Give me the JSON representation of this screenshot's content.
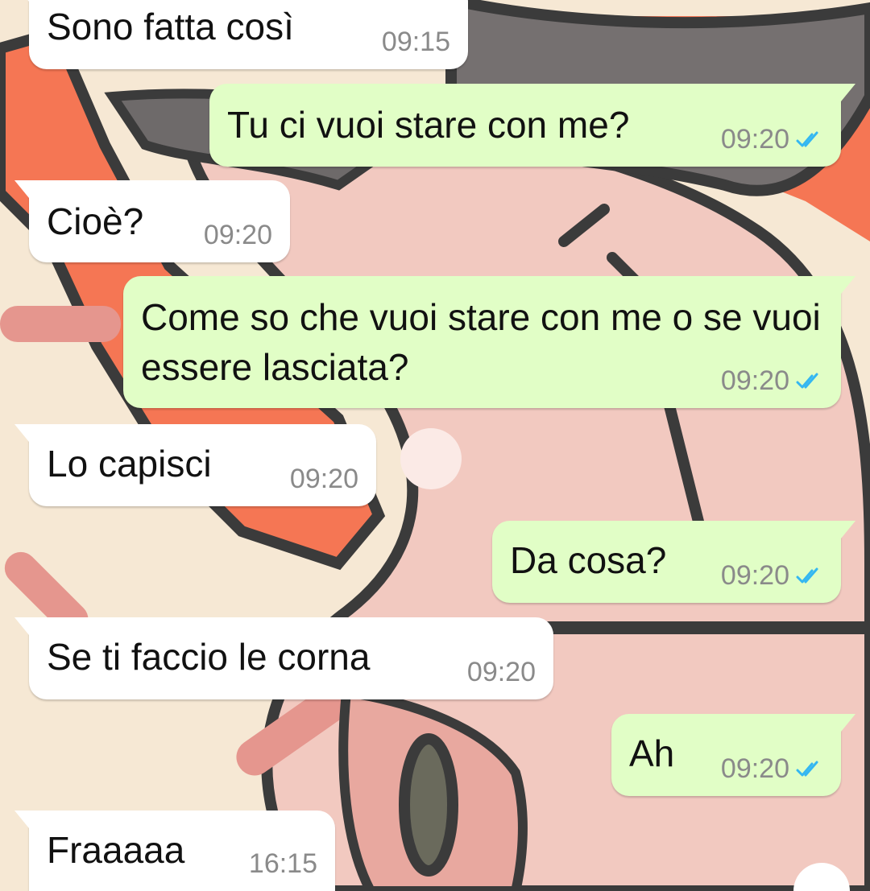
{
  "messages": [
    {
      "dir": "in",
      "text": "Sono fatta così",
      "time": "09:15"
    },
    {
      "dir": "out",
      "text": "Tu ci vuoi stare con me?",
      "time": "09:20",
      "status": "read-ticks"
    },
    {
      "dir": "in",
      "text": "Cioè?",
      "time": "09:20"
    },
    {
      "dir": "out",
      "text": "Come so che vuoi stare con me o se vuoi essere lasciata?",
      "time": "09:20",
      "status": "read-ticks"
    },
    {
      "dir": "in",
      "text": "Lo capisci",
      "time": "09:20"
    },
    {
      "dir": "out",
      "text": "Da cosa?",
      "time": "09:20",
      "status": "read-ticks"
    },
    {
      "dir": "in",
      "text": "Se ti faccio le corna",
      "time": "09:20"
    },
    {
      "dir": "out",
      "text": "Ah",
      "time": "09:20",
      "status": "read-ticks"
    },
    {
      "dir": "in",
      "text": "Fraaaaa",
      "time": "16:15"
    }
  ],
  "colors": {
    "incoming_bubble": "#ffffff",
    "outgoing_bubble": "#e1fec6",
    "read_ticks": "#34b7f1",
    "timestamp": "#8a8a8a"
  }
}
